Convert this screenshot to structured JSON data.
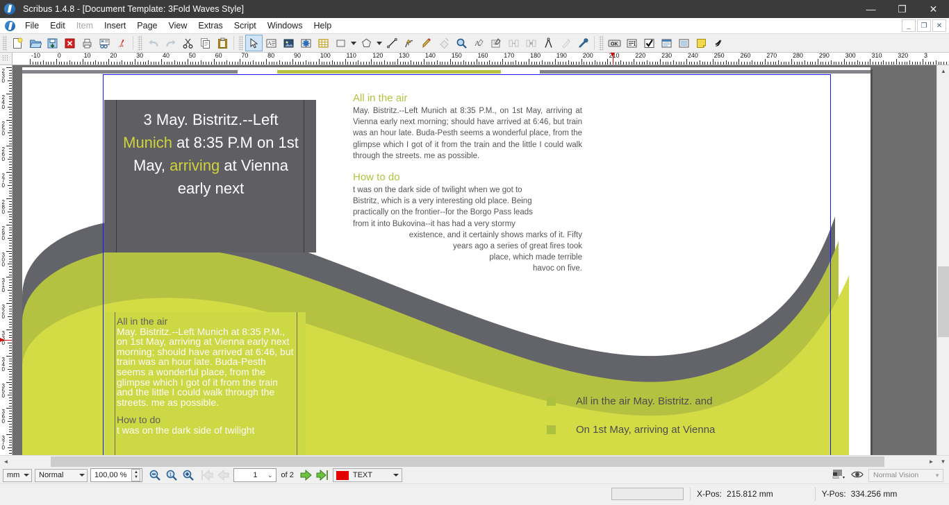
{
  "window": {
    "title": "Scribus 1.4.8 - [Document Template: 3Fold Waves Style]",
    "minimize": "—",
    "maximize": "❐",
    "close": "✕",
    "doc_minimize": "_",
    "doc_restore": "❐",
    "doc_close": "✕"
  },
  "menubar": {
    "items": [
      {
        "label": "File",
        "disabled": false
      },
      {
        "label": "Edit",
        "disabled": false
      },
      {
        "label": "Item",
        "disabled": true
      },
      {
        "label": "Insert",
        "disabled": false
      },
      {
        "label": "Page",
        "disabled": false
      },
      {
        "label": "View",
        "disabled": false
      },
      {
        "label": "Extras",
        "disabled": false
      },
      {
        "label": "Script",
        "disabled": false
      },
      {
        "label": "Windows",
        "disabled": false
      },
      {
        "label": "Help",
        "disabled": false
      }
    ]
  },
  "toolbar": {
    "groups": [
      {
        "buttons": [
          {
            "name": "new-document",
            "tooltip": "New"
          },
          {
            "name": "open-document",
            "tooltip": "Open"
          },
          {
            "name": "save-document",
            "tooltip": "Save"
          },
          {
            "name": "close-document",
            "tooltip": "Close"
          },
          {
            "name": "print-document",
            "tooltip": "Print"
          },
          {
            "name": "preflight-verifier",
            "tooltip": "Preflight Verifier"
          },
          {
            "name": "save-as-pdf",
            "tooltip": "Save as PDF"
          }
        ]
      },
      {
        "buttons": [
          {
            "name": "undo",
            "tooltip": "Undo",
            "disabled": true
          },
          {
            "name": "redo",
            "tooltip": "Redo",
            "disabled": true
          },
          {
            "name": "cut",
            "tooltip": "Cut"
          },
          {
            "name": "copy",
            "tooltip": "Copy"
          },
          {
            "name": "paste",
            "tooltip": "Paste"
          }
        ]
      },
      {
        "buttons": [
          {
            "name": "select-item",
            "tooltip": "Select Item",
            "active": true
          },
          {
            "name": "insert-text-frame",
            "tooltip": "Insert Text Frame"
          },
          {
            "name": "insert-image-frame",
            "tooltip": "Insert Image Frame"
          },
          {
            "name": "insert-render-frame",
            "tooltip": "Insert Render Frame"
          },
          {
            "name": "insert-table",
            "tooltip": "Insert Table"
          },
          {
            "name": "insert-shape",
            "tooltip": "Insert Shape"
          },
          {
            "name": "insert-shape-dropdown",
            "tooltip": "Shape options"
          },
          {
            "name": "insert-polygon",
            "tooltip": "Insert Polygon"
          },
          {
            "name": "insert-polygon-dropdown",
            "tooltip": "Polygon options"
          },
          {
            "name": "insert-line",
            "tooltip": "Insert Line"
          },
          {
            "name": "insert-bezier-curve",
            "tooltip": "Insert Bezier Curve"
          },
          {
            "name": "insert-freehand-line",
            "tooltip": "Insert Freehand Line"
          },
          {
            "name": "rotate-item",
            "tooltip": "Rotate Item"
          },
          {
            "name": "zoom-tool",
            "tooltip": "Zoom"
          },
          {
            "name": "edit-contents-of-frame",
            "tooltip": "Edit Contents of Frame"
          },
          {
            "name": "edit-text-with-story-editor",
            "tooltip": "Edit Text with Story Editor"
          },
          {
            "name": "link-text-frames",
            "tooltip": "Link Text Frames",
            "disabled": true
          },
          {
            "name": "unlink-text-frames",
            "tooltip": "Unlink Text Frames",
            "disabled": true
          },
          {
            "name": "measurements",
            "tooltip": "Measurements"
          },
          {
            "name": "copy-item-properties",
            "tooltip": "Copy Item Properties",
            "disabled": true
          },
          {
            "name": "eye-dropper",
            "tooltip": "Eye Dropper"
          }
        ]
      },
      {
        "buttons": [
          {
            "name": "pdf-push-button",
            "tooltip": "PDF Push Button"
          },
          {
            "name": "pdf-text-field",
            "tooltip": "PDF Text Field"
          },
          {
            "name": "pdf-check-box",
            "tooltip": "PDF Check Box"
          },
          {
            "name": "pdf-combo-box",
            "tooltip": "PDF Combo Box"
          },
          {
            "name": "pdf-list-box",
            "tooltip": "PDF List Box"
          },
          {
            "name": "pdf-annotation",
            "tooltip": "PDF Text Annotation"
          },
          {
            "name": "pdf-link-annotation",
            "tooltip": "PDF Link Annotation"
          }
        ]
      }
    ]
  },
  "rulers": {
    "unit": "mm",
    "horizontal_labels": [
      "-10",
      "0",
      "10",
      "20",
      "30",
      "40",
      "50",
      "60",
      "70",
      "80",
      "90",
      "100",
      "110",
      "120",
      "130",
      "140",
      "150",
      "160",
      "170",
      "180",
      "190",
      "200",
      "210",
      "220",
      "230",
      "240",
      "250",
      "260",
      "270",
      "280",
      "290",
      "300",
      "310",
      "320",
      "3"
    ],
    "horizontal_start": -10,
    "horizontal_marker": 212,
    "vertical_labels": [
      "230",
      "240",
      "250",
      "260",
      "270",
      "280",
      "290",
      "300",
      "310",
      "320",
      "330",
      "340",
      "350",
      "360",
      "370"
    ],
    "vertical_start": 230,
    "vertical_marker": 334
  },
  "document": {
    "dark_heading_box": {
      "segments": [
        {
          "text": "3 May. Bistritz.--Left ",
          "highlight": false
        },
        {
          "text": "Munich",
          "highlight": true
        },
        {
          "text": " at 8:35 P.M on 1st May, ",
          "highlight": false
        },
        {
          "text": "arriving",
          "highlight": true
        },
        {
          "text": " at Vienna early next",
          "highlight": false
        }
      ]
    },
    "right_column": {
      "section1_heading": "All in the air",
      "section1_body": "May. Bistritz.--Left Munich at 8:35 P.M., on 1st May, arriving at Vienna early next morning; should have arrived at 6:46, but train was an hour late. Buda-Pesth seems a wonderful place, from the glimpse which I got of it from the train and the little I could walk through the streets. me as possible.",
      "section2_heading": "How to do",
      "section2_lines": [
        "t was on the dark side of twilight when we got to",
        "Bistritz, which is a very interesting old place. Being",
        "practically on the frontier--for the Borgo Pass leads",
        "from it into Bukovina--it has had a very stormy",
        "existence, and it certainly shows marks of it. Fifty",
        "years ago a series of great fires took",
        "place, which made terrible",
        "havoc on five."
      ]
    },
    "green_box": {
      "heading1": "All in the air",
      "body1": "May. Bistritz.--Left Munich at 8:35 P.M., on 1st May, arriving at Vienna early next morning; should have arrived at 6:46, but train was an hour late. Buda-Pesth seems a wonderful place, from the glimpse which I got of it from the train and the little I could walk through the streets. me as possible.",
      "heading2": "How to do",
      "body2": "t was on the dark side of twilight"
    },
    "bullets": [
      "All in the air May. Bistritz. and",
      "On 1st May, arriving at Vienna"
    ],
    "colors": {
      "wave_dark": "#63636a",
      "wave_olive": "#b5c141",
      "wave_light": "#d3dc45",
      "accent_green": "#b3c23f",
      "dark_box": "#5f5f63",
      "green_box": "#cdd845",
      "selection_blue": "#1414ff"
    }
  },
  "statusbar": {
    "unit_selector": "mm",
    "quality_selector": "Normal",
    "zoom_value": "100,00 %",
    "zoom_out": "zoom-out-icon",
    "zoom_100": "zoom-100-icon",
    "zoom_in": "zoom-in-icon",
    "first_page": "first-page-icon",
    "previous_page": "previous-page-icon",
    "current_page": "1",
    "of_pages": "of 2",
    "next_page": "next-page-icon",
    "last_page": "last-page-icon",
    "layer_name": "TEXT",
    "layer_color": "#e40000",
    "preview_mode": "Normal Vision",
    "xpos_label": "X-Pos:",
    "xpos_value": "215.812 mm",
    "ypos_label": "Y-Pos:",
    "ypos_value": "334.256 mm"
  }
}
